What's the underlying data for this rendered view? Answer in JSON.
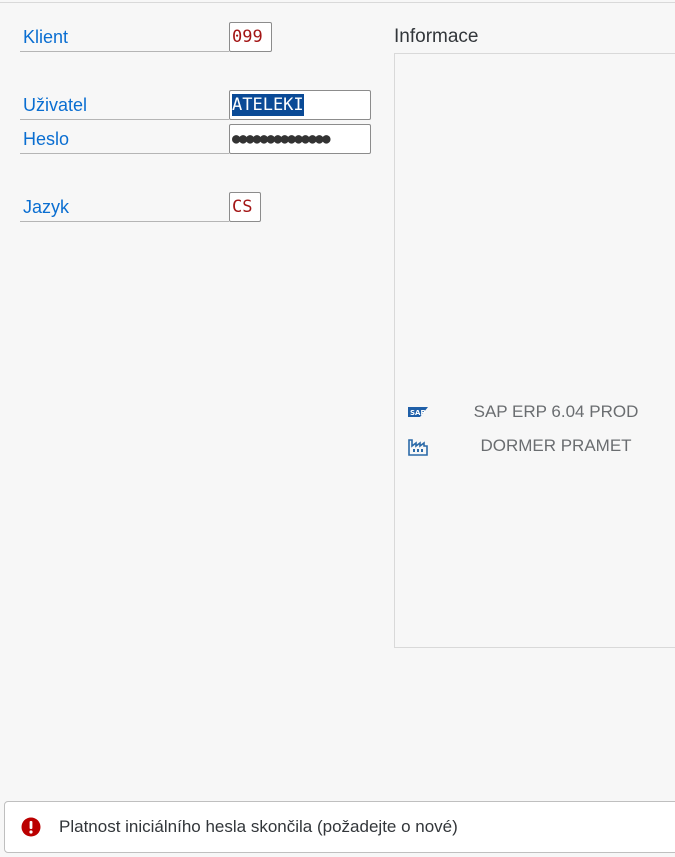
{
  "login": {
    "client_label": "Klient",
    "client_value": "099",
    "user_label": "Uživatel",
    "user_value": "ATELEKI",
    "password_label": "Heslo",
    "password_mask": "●●●●●●●●●●●●●●",
    "language_label": "Jazyk",
    "language_value": "CS"
  },
  "info": {
    "title": "Informace",
    "rows": [
      {
        "icon": "sap-logo-icon",
        "text": "SAP ERP 6.04  PROD"
      },
      {
        "icon": "factory-icon",
        "text": "DORMER PRAMET"
      }
    ]
  },
  "status": {
    "icon": "error-icon",
    "message": "Platnost iniciálního hesla skončila (požadejte o nové)",
    "color": "#bb0000"
  },
  "colors": {
    "label": "#0a6ed1",
    "input_text": "#a31515",
    "selection": "#0a4a96"
  }
}
